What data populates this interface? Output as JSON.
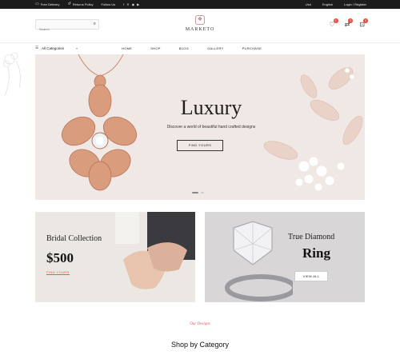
{
  "topbar": {
    "items_left": [
      "Free Delivery",
      "Returns Policy",
      "Follow Us"
    ],
    "social": [
      "f",
      "✕",
      "◉",
      "▶"
    ],
    "lang": "Usd",
    "language": "English",
    "account": "Login / Register"
  },
  "header": {
    "search_placeholder": "Search",
    "logo": "MARKETO",
    "wishlist_count": "0",
    "compare_count": "0",
    "cart_count": "0"
  },
  "nav": {
    "categories_label": "All Categories",
    "menu": [
      "HOME",
      "SHOP",
      "BLOG",
      "GALLERY",
      "PURCHASE"
    ]
  },
  "hero": {
    "title": "Luxury",
    "subtitle": "Discover a world of beautiful hand crafted designs",
    "button": "FIND YOURS"
  },
  "promo_left": {
    "title": "Bridal Collection",
    "price": "$500",
    "link": "FIND YOURS"
  },
  "promo_right": {
    "title": "True Diamond",
    "big": "Ring",
    "button": "VIEW ALL"
  },
  "section": {
    "kicker": "Our Designs",
    "title": "Shop by Category"
  },
  "colors": {
    "accent": "#e8483a",
    "topbar": "#1c1c1c",
    "hero_bg": "#f0e8e4"
  }
}
